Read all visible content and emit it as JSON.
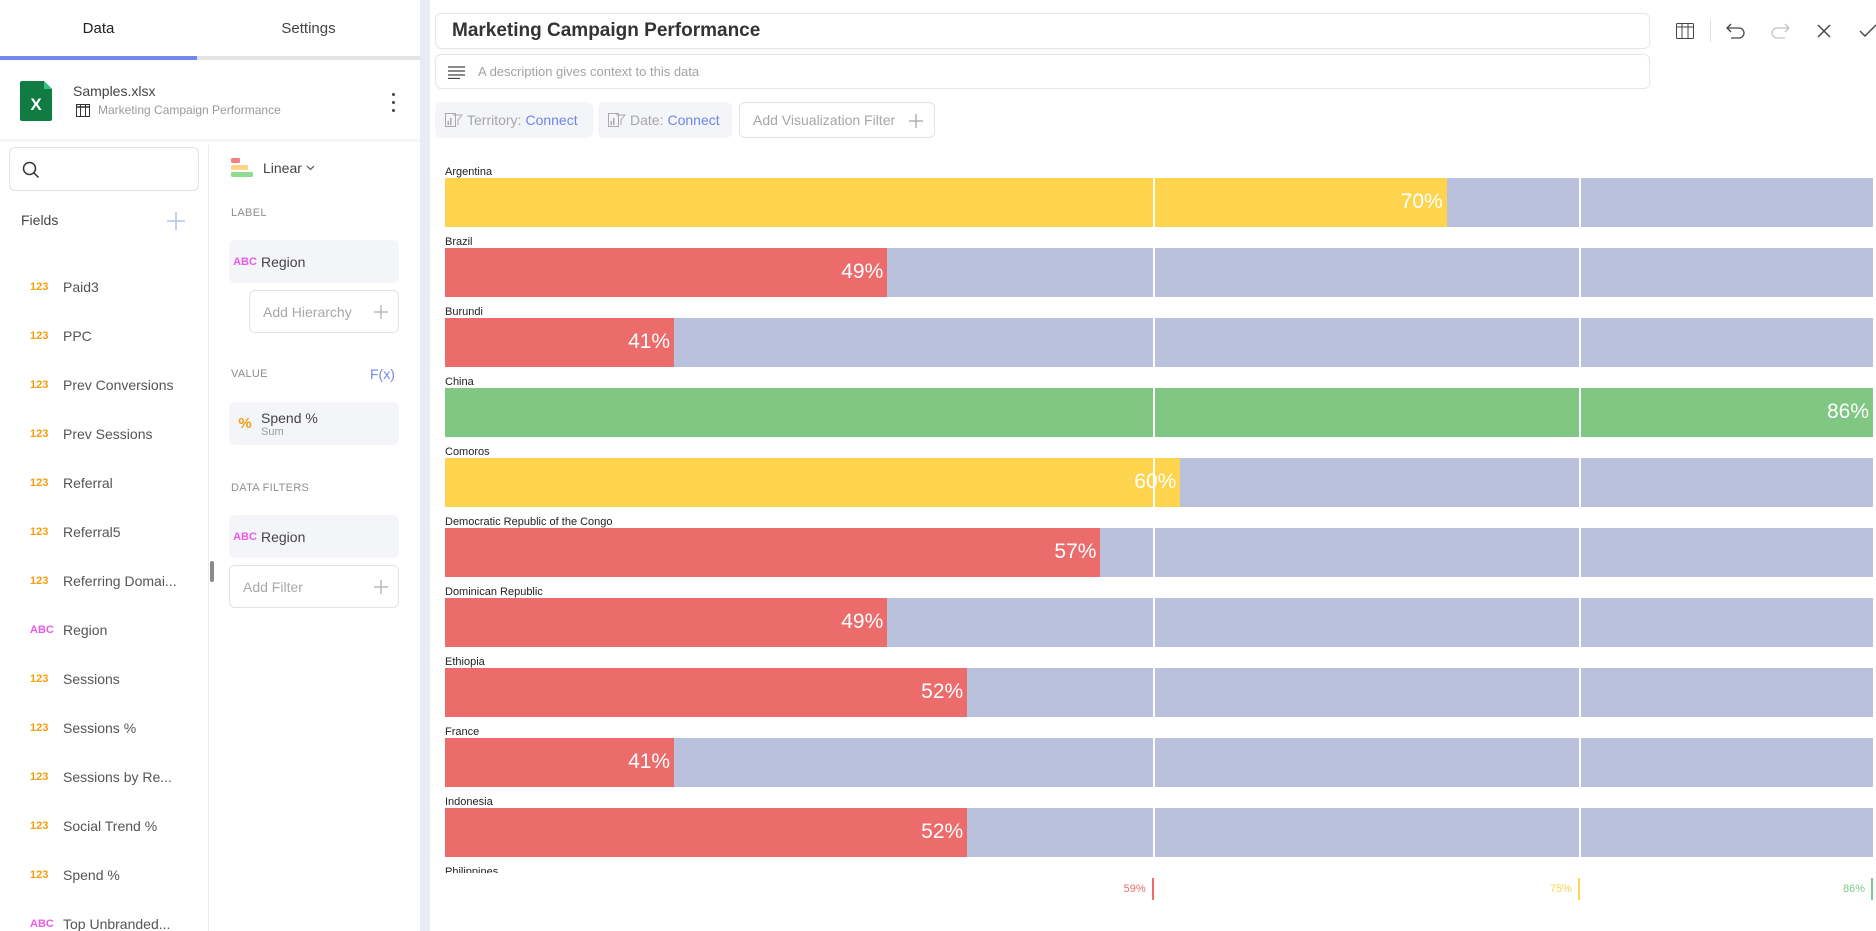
{
  "left_panel": {
    "tabs": [
      {
        "label": "Data",
        "active": true
      },
      {
        "label": "Settings",
        "active": false
      }
    ],
    "source": {
      "file_name": "Samples.xlsx",
      "sheet_name": "Marketing Campaign Performance",
      "icon": "excel-file-icon"
    },
    "fields": {
      "title": "Fields",
      "search_placeholder": "",
      "items": [
        {
          "type": "123",
          "name": "Paid3"
        },
        {
          "type": "123",
          "name": "PPC"
        },
        {
          "type": "123",
          "name": "Prev Conversions"
        },
        {
          "type": "123",
          "name": "Prev Sessions"
        },
        {
          "type": "123",
          "name": "Referral"
        },
        {
          "type": "123",
          "name": "Referral5"
        },
        {
          "type": "123",
          "name": "Referring Domai..."
        },
        {
          "type": "ABC",
          "name": "Region"
        },
        {
          "type": "123",
          "name": "Sessions"
        },
        {
          "type": "123",
          "name": "Sessions %"
        },
        {
          "type": "123",
          "name": "Sessions by Re..."
        },
        {
          "type": "123",
          "name": "Social Trend %"
        },
        {
          "type": "123",
          "name": "Spend %"
        },
        {
          "type": "ABC",
          "name": "Top Unbranded..."
        }
      ]
    },
    "config": {
      "viz_type": "Linear",
      "label_section": "LABEL",
      "label_field": {
        "type": "ABC",
        "name": "Region"
      },
      "add_hierarchy": "Add Hierarchy",
      "value_section": "VALUE",
      "fx_label": "F(x)",
      "value_field": {
        "type": "%",
        "name": "Spend %",
        "aggregation": "Sum"
      },
      "filters_section": "DATA FILTERS",
      "filter_field": {
        "type": "ABC",
        "name": "Region"
      },
      "add_filter": "Add Filter"
    }
  },
  "main": {
    "title": "Marketing Campaign Performance",
    "description_placeholder": "A description gives context to this data",
    "toolbar": [
      "table-view-icon",
      "undo-icon",
      "redo-icon",
      "close-icon",
      "check-icon"
    ],
    "filter_chips": [
      {
        "label": "Territory:",
        "link": "Connect"
      },
      {
        "label": "Date:",
        "link": "Connect"
      }
    ],
    "add_viz_filter": "Add Visualization Filter"
  },
  "colors": {
    "accent": "#7189e8",
    "bad": "#ec6b6b",
    "mid": "#fed44f",
    "good": "#81c784",
    "track": "#b9c1dc"
  },
  "chart_data": {
    "type": "bar",
    "subtype": "linear-gauge",
    "categories": [
      "Argentina",
      "Brazil",
      "Burundi",
      "China",
      "Comoros",
      "Democratic Republic of the Congo",
      "Dominican Republic",
      "Ethiopia",
      "France",
      "Indonesia",
      "Philippines"
    ],
    "values": [
      70,
      49,
      41,
      86,
      60,
      57,
      49,
      52,
      41,
      52,
      null
    ],
    "value_labels": [
      "70%",
      "49%",
      "41%",
      "86%",
      "60%",
      "57%",
      "49%",
      "52%",
      "41%",
      "52%",
      ""
    ],
    "xlim": [
      32.4,
      86
    ],
    "bands": [
      {
        "upto": 59,
        "label": "59%",
        "color": "#ec6b6b"
      },
      {
        "upto": 75,
        "label": "75%",
        "color": "#fed44f"
      },
      {
        "upto": 86,
        "label": "86%",
        "color": "#81c784"
      }
    ],
    "title": "Marketing Campaign Performance",
    "xlabel": "",
    "ylabel": "",
    "grid": false
  }
}
